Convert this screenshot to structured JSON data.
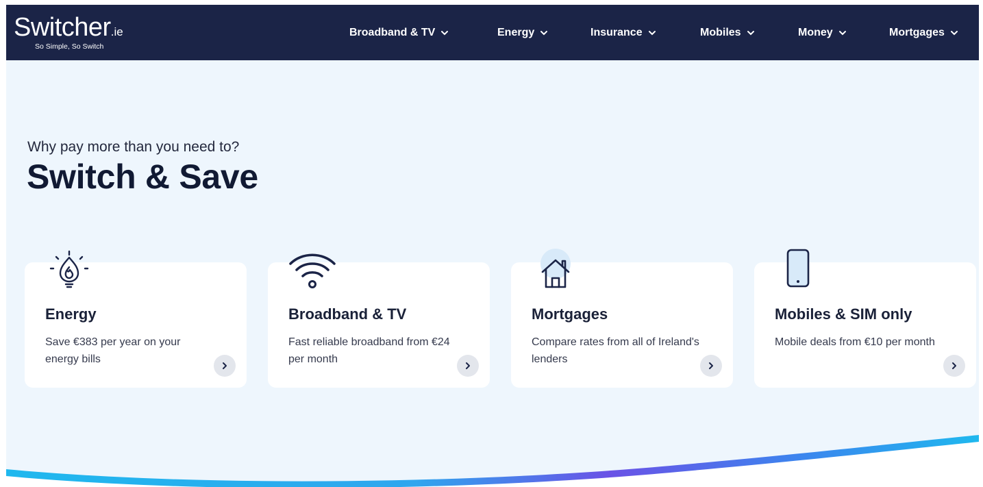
{
  "brand": {
    "name_main": "Switcher",
    "name_suffix": ".ie",
    "tagline": "So Simple, So Switch"
  },
  "nav": {
    "items": [
      {
        "label": "Broadband & TV"
      },
      {
        "label": "Energy"
      },
      {
        "label": "Insurance"
      },
      {
        "label": "Mobiles"
      },
      {
        "label": "Money"
      },
      {
        "label": "Mortgages"
      }
    ]
  },
  "hero": {
    "kicker": "Why pay more than you need to?",
    "title": "Switch & Save"
  },
  "cards": [
    {
      "icon": "gas-flame-bulb-icon",
      "title": "Energy",
      "description": "Save €383 per year on your energy bills"
    },
    {
      "icon": "wifi-icon",
      "title": "Broadband & TV",
      "description": "Fast reliable broadband from €24 per month"
    },
    {
      "icon": "house-icon",
      "title": "Mortgages",
      "description": "Compare rates from all of Ireland's lenders"
    },
    {
      "icon": "mobile-phone-icon",
      "title": "Mobiles & SIM only",
      "description": "Mobile deals from €10 per month"
    }
  ],
  "colors": {
    "nav_bg": "#1b2447",
    "page_bg": "#eef6fd",
    "card_bg": "#ffffff",
    "heading": "#111a33",
    "wave_cyan": "#1fb8ee",
    "wave_purple": "#6a52e6"
  }
}
